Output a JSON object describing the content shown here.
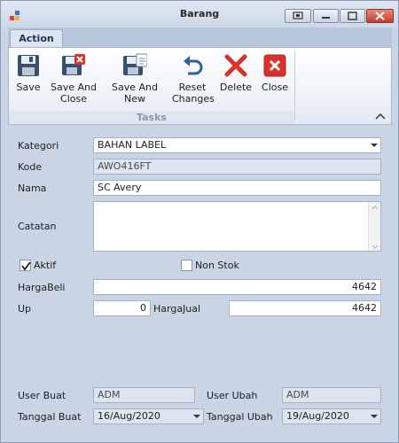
{
  "window": {
    "title": "Barang",
    "icon": "app-form-icon"
  },
  "tabs": [
    {
      "label": "Action",
      "active": true
    }
  ],
  "ribbon": {
    "buttons": [
      {
        "name": "save-button",
        "icon": "floppy-disk-icon",
        "label": "Save"
      },
      {
        "name": "save-and-close-button",
        "icon": "floppy-disk-close-icon",
        "label": "Save And\nClose"
      },
      {
        "name": "save-and-new-button",
        "icon": "floppy-disk-new-icon",
        "label": "Save And New"
      },
      {
        "name": "reset-changes-button",
        "icon": "undo-arrow-icon",
        "label": "Reset\nChanges"
      },
      {
        "name": "delete-button",
        "icon": "red-x-icon",
        "label": "Delete"
      },
      {
        "name": "close-button",
        "icon": "red-square-x-icon",
        "label": "Close"
      }
    ],
    "group_label": "Tasks"
  },
  "form": {
    "kategori": {
      "label": "Kategori",
      "value": "BAHAN LABEL"
    },
    "kode": {
      "label": "Kode",
      "value": "AWO416FT"
    },
    "nama": {
      "label": "Nama",
      "value": "SC Avery"
    },
    "catatan": {
      "label": "Catatan",
      "value": ""
    },
    "aktif": {
      "label": "Aktif",
      "checked": true
    },
    "non_stok": {
      "label": "Non Stok",
      "checked": false
    },
    "harga_beli": {
      "label": "HargaBeli",
      "value": "4642"
    },
    "up": {
      "label": "Up",
      "value": "0"
    },
    "harga_jual": {
      "label": "HargaJual",
      "value": "4642"
    },
    "user_buat": {
      "label": "User Buat",
      "value": "ADM"
    },
    "user_ubah": {
      "label": "User Ubah",
      "value": "ADM"
    },
    "tanggal_buat": {
      "label": "Tanggal Buat",
      "value": "16/Aug/2020"
    },
    "tanggal_ubah": {
      "label": "Tanggal Ubah",
      "value": "19/Aug/2020"
    }
  },
  "colors": {
    "accent_red": "#d9312b",
    "accent_blue": "#2f5f9e",
    "form_bg": "#c9d4e4"
  }
}
